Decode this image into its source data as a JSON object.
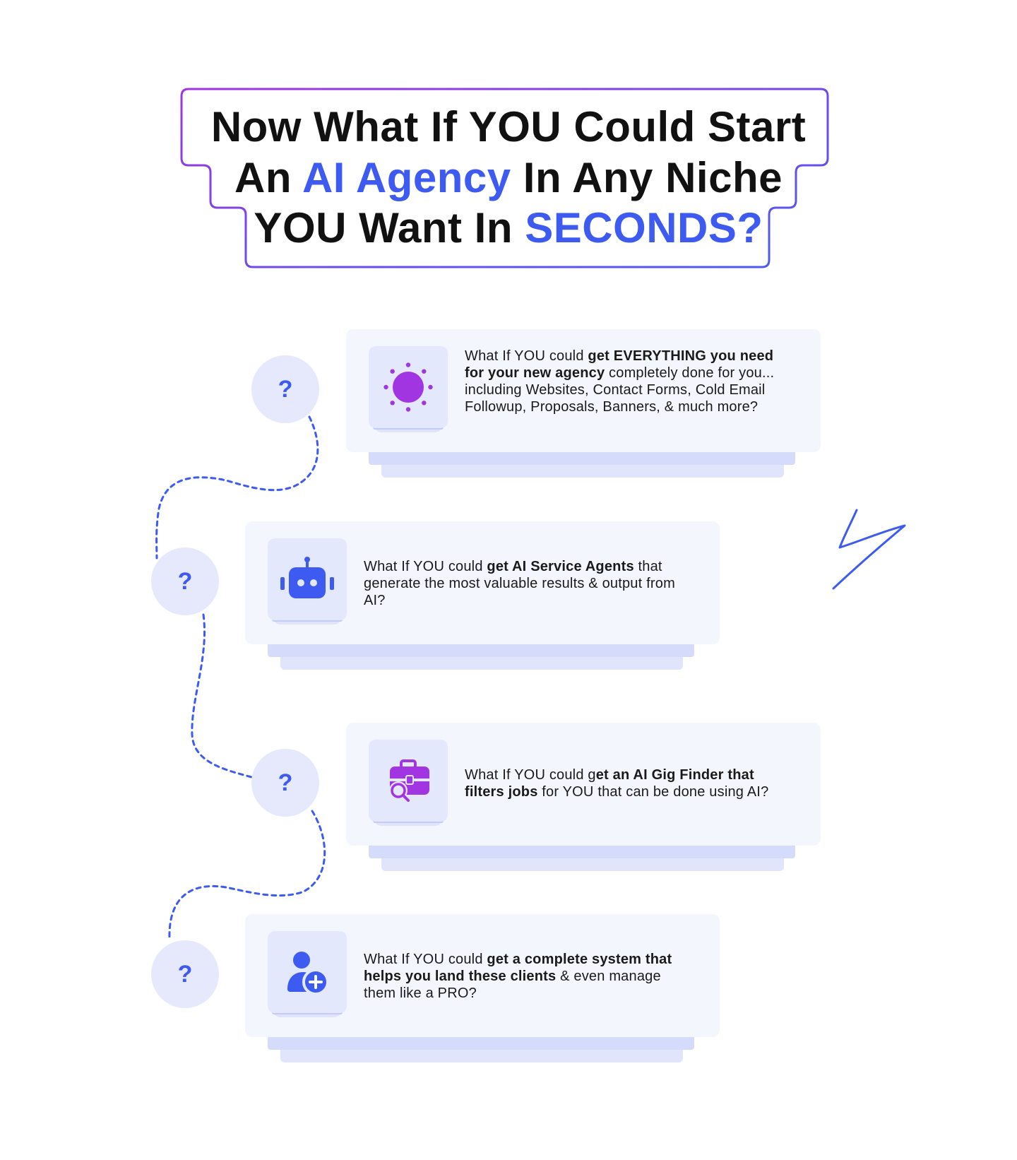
{
  "headline": {
    "line1": "Now What If YOU Could Start",
    "line2_pre": "An ",
    "line2_accent": "AI Agency",
    "line2_post": " In Any Niche",
    "line3_pre": "YOU Want In ",
    "line3_accent": "SECONDS?"
  },
  "colors": {
    "accent_blue": "#3d5af1",
    "accent_purple": "#a135e2",
    "frame_gradient": [
      "#a034e0",
      "#4a5cf0"
    ]
  },
  "cards": [
    {
      "icon": "sun-icon",
      "marker": "?",
      "text_pre": "What If YOU could ",
      "text_bold": "get EVERYTHING you need for your new agency",
      "text_post": " completely done for you... including Websites, Contact Forms, Cold Email Followup, Proposals, Banners, & much more?"
    },
    {
      "icon": "robot-icon",
      "marker": "?",
      "text_pre": "What If YOU could ",
      "text_bold": "get AI Service Agents",
      "text_post": " that generate the most valuable results & output from AI?"
    },
    {
      "icon": "briefcase-search-icon",
      "marker": "?",
      "text_pre": "What If YOU could g",
      "text_bold": "et an AI Gig Finder that filters jobs",
      "text_post": " for YOU that can be done using AI?"
    },
    {
      "icon": "add-user-icon",
      "marker": "?",
      "text_pre": "What If YOU could ",
      "text_bold": "get a complete system that helps you land these clients",
      "text_post": " & even manage them like a PRO?"
    }
  ],
  "decorations": {
    "lightning": "lightning-scribble-icon"
  }
}
